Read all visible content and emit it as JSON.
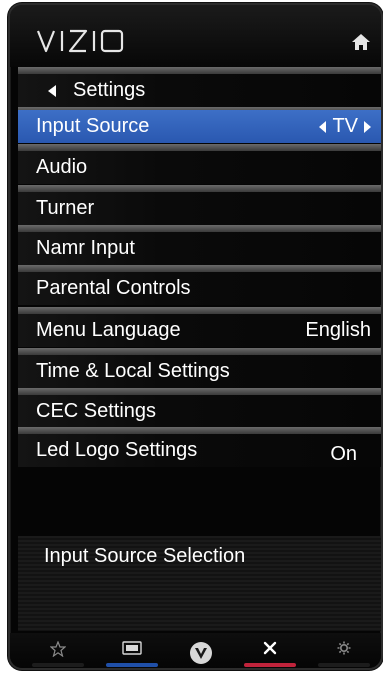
{
  "header": {
    "logo_text": "VIZIO",
    "home_icon": "home-icon"
  },
  "menu": {
    "title": "Settings",
    "items": [
      {
        "label": "Input Source",
        "value": "TV",
        "selected": true
      },
      {
        "label": "Audio",
        "value": ""
      },
      {
        "label": "Turner",
        "value": ""
      },
      {
        "label": "Namr Input",
        "value": ""
      },
      {
        "label": "Parental Controls",
        "value": ""
      },
      {
        "label": "Menu Language",
        "value": "English"
      },
      {
        "label": "Time & Local Settings",
        "value": ""
      },
      {
        "label": "CEC Settings",
        "value": ""
      },
      {
        "label": "Led Logo Settings",
        "value": "On"
      }
    ]
  },
  "description": {
    "text": "Input Source Selection"
  },
  "footer": {
    "buttons": [
      {
        "icon": "star-icon",
        "bar_color": "#1a1a1a"
      },
      {
        "icon": "screen-icon",
        "bar_color": "#1f4fa8"
      },
      {
        "icon": "vizio-v-icon",
        "bar_color": ""
      },
      {
        "icon": "close-icon",
        "bar_color": "#c0233b"
      },
      {
        "icon": "gear-icon",
        "bar_color": "#1a1a1a"
      }
    ]
  },
  "colors": {
    "selected_row": "#2f5fb8",
    "background": "#050505"
  }
}
